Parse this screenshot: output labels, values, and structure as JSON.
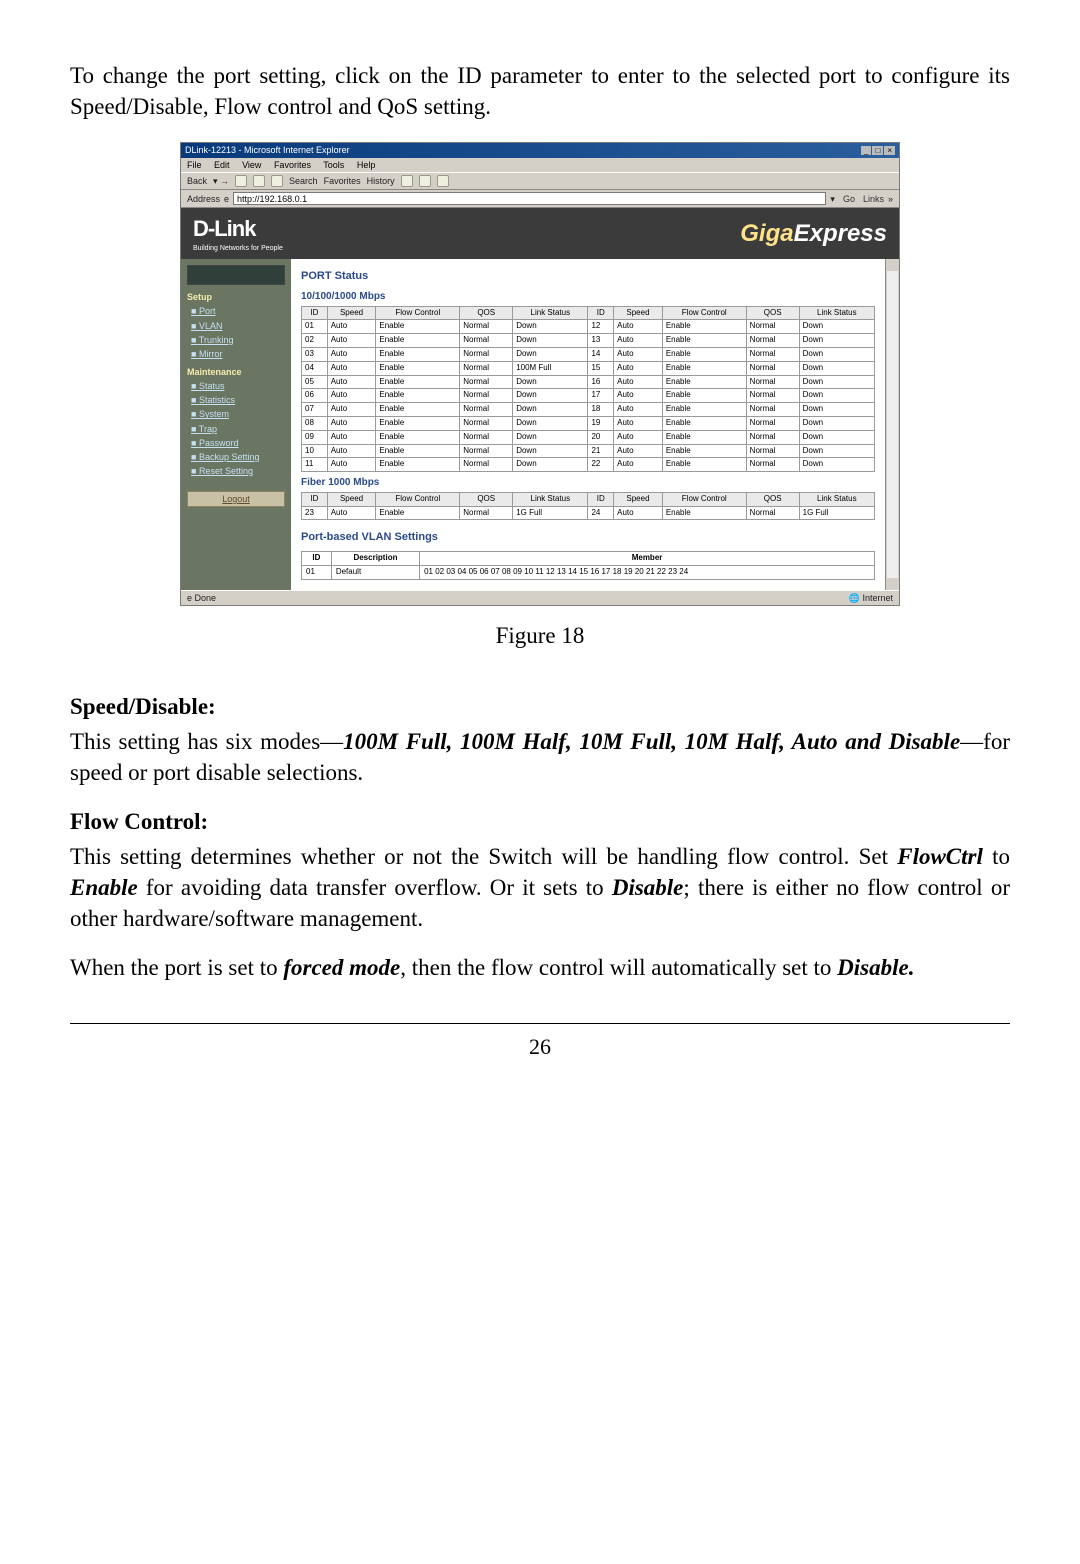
{
  "intro": "To change the port setting, click on the ID parameter to enter to the selected port to configure its Speed/Disable, Flow control and QoS setting.",
  "browser": {
    "title": "DLink-12213 - Microsoft Internet Explorer",
    "menus": [
      "File",
      "Edit",
      "View",
      "Favorites",
      "Tools",
      "Help"
    ],
    "toolbar": [
      "Back",
      "",
      "",
      "",
      "",
      "Search",
      "Favorites",
      "History",
      "",
      "",
      ""
    ],
    "address_label": "Address",
    "address_value": "http://192.168.0.1",
    "go_label": "Go",
    "links_label": "Links"
  },
  "branding": {
    "logo": "D-Link",
    "logo_sub": "Building Networks for People",
    "product_a": "Giga",
    "product_b": "Express"
  },
  "sidebar": {
    "setup": "Setup",
    "links1": [
      "Port",
      "VLAN",
      "Trunking",
      "Mirror"
    ],
    "maint": "Maintenance",
    "links2": [
      "Status",
      "Statistics",
      "System",
      "Trap",
      "Password",
      "Backup Setting",
      "Reset Setting"
    ],
    "logout": "Logout"
  },
  "main": {
    "port_status": "PORT Status",
    "mbps_header": "10/100/1000 Mbps",
    "fiber_header": "Fiber 1000 Mbps",
    "cols": [
      "ID",
      "Speed",
      "Flow Control",
      "QOS",
      "Link Status"
    ],
    "rows_left": [
      {
        "id": "01",
        "speed": "Auto",
        "fc": "Enable",
        "qos": "Normal",
        "link": "Down"
      },
      {
        "id": "02",
        "speed": "Auto",
        "fc": "Enable",
        "qos": "Normal",
        "link": "Down"
      },
      {
        "id": "03",
        "speed": "Auto",
        "fc": "Enable",
        "qos": "Normal",
        "link": "Down"
      },
      {
        "id": "04",
        "speed": "Auto",
        "fc": "Enable",
        "qos": "Normal",
        "link": "100M Full"
      },
      {
        "id": "05",
        "speed": "Auto",
        "fc": "Enable",
        "qos": "Normal",
        "link": "Down"
      },
      {
        "id": "06",
        "speed": "Auto",
        "fc": "Enable",
        "qos": "Normal",
        "link": "Down"
      },
      {
        "id": "07",
        "speed": "Auto",
        "fc": "Enable",
        "qos": "Normal",
        "link": "Down"
      },
      {
        "id": "08",
        "speed": "Auto",
        "fc": "Enable",
        "qos": "Normal",
        "link": "Down"
      },
      {
        "id": "09",
        "speed": "Auto",
        "fc": "Enable",
        "qos": "Normal",
        "link": "Down"
      },
      {
        "id": "10",
        "speed": "Auto",
        "fc": "Enable",
        "qos": "Normal",
        "link": "Down"
      },
      {
        "id": "11",
        "speed": "Auto",
        "fc": "Enable",
        "qos": "Normal",
        "link": "Down"
      }
    ],
    "rows_right": [
      {
        "id": "12",
        "speed": "Auto",
        "fc": "Enable",
        "qos": "Normal",
        "link": "Down"
      },
      {
        "id": "13",
        "speed": "Auto",
        "fc": "Enable",
        "qos": "Normal",
        "link": "Down"
      },
      {
        "id": "14",
        "speed": "Auto",
        "fc": "Enable",
        "qos": "Normal",
        "link": "Down"
      },
      {
        "id": "15",
        "speed": "Auto",
        "fc": "Enable",
        "qos": "Normal",
        "link": "Down"
      },
      {
        "id": "16",
        "speed": "Auto",
        "fc": "Enable",
        "qos": "Normal",
        "link": "Down"
      },
      {
        "id": "17",
        "speed": "Auto",
        "fc": "Enable",
        "qos": "Normal",
        "link": "Down"
      },
      {
        "id": "18",
        "speed": "Auto",
        "fc": "Enable",
        "qos": "Normal",
        "link": "Down"
      },
      {
        "id": "19",
        "speed": "Auto",
        "fc": "Enable",
        "qos": "Normal",
        "link": "Down"
      },
      {
        "id": "20",
        "speed": "Auto",
        "fc": "Enable",
        "qos": "Normal",
        "link": "Down"
      },
      {
        "id": "21",
        "speed": "Auto",
        "fc": "Enable",
        "qos": "Normal",
        "link": "Down"
      },
      {
        "id": "22",
        "speed": "Auto",
        "fc": "Enable",
        "qos": "Normal",
        "link": "Down"
      }
    ],
    "fiber_row": {
      "id": "23",
      "speed": "Auto",
      "fc": "Enable",
      "qos": "Normal",
      "link": "1G Full"
    },
    "fiber_row_r": {
      "id": "24",
      "speed": "Auto",
      "fc": "Enable",
      "qos": "Normal",
      "link": "1G Full"
    },
    "vlan_head": "Port-based VLAN Settings",
    "vlan_cols": [
      "ID",
      "Description",
      "Member"
    ],
    "vlan_row": {
      "id": "01",
      "desc": "Default",
      "member": "01 02 03 04 05 06 07 08 09 10 11 12 13 14 15 16 17 18 19 20 21 22 23 24"
    }
  },
  "status": {
    "left": "Done",
    "right": "Internet"
  },
  "caption": "Figure 18",
  "sections": {
    "speed_title": "Speed/Disable:",
    "speed_body_a": "This setting has six modes—",
    "speed_modes": "100M Full, 100M Half, 10M Full, 10M Half, Auto and Disable",
    "speed_body_b": "—for speed or port disable selections.",
    "flow_title": "Flow Control:",
    "flow_p1_a": "This setting determines whether or not the Switch will be handling flow control. Set ",
    "flow_p1_b": "FlowCtrl",
    "flow_p1_c": " to ",
    "flow_p1_d": "Enable",
    "flow_p1_e": " for avoiding data transfer overflow. Or it sets to ",
    "flow_p1_f": "Disable",
    "flow_p1_g": "; there is either no flow control or other hardware/software management.",
    "flow_p2_a": "When the port is set to ",
    "flow_p2_b": "forced mode",
    "flow_p2_c": ", then the flow control will automatically set to ",
    "flow_p2_d": "Disable."
  },
  "page": "26"
}
